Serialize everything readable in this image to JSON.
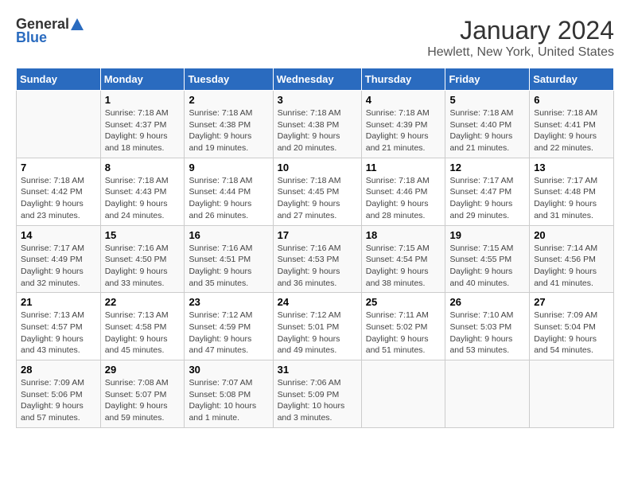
{
  "logo": {
    "general": "General",
    "blue": "Blue"
  },
  "title": "January 2024",
  "subtitle": "Hewlett, New York, United States",
  "headers": [
    "Sunday",
    "Monday",
    "Tuesday",
    "Wednesday",
    "Thursday",
    "Friday",
    "Saturday"
  ],
  "weeks": [
    [
      {
        "day": "",
        "info": ""
      },
      {
        "day": "1",
        "info": "Sunrise: 7:18 AM\nSunset: 4:37 PM\nDaylight: 9 hours\nand 18 minutes."
      },
      {
        "day": "2",
        "info": "Sunrise: 7:18 AM\nSunset: 4:38 PM\nDaylight: 9 hours\nand 19 minutes."
      },
      {
        "day": "3",
        "info": "Sunrise: 7:18 AM\nSunset: 4:38 PM\nDaylight: 9 hours\nand 20 minutes."
      },
      {
        "day": "4",
        "info": "Sunrise: 7:18 AM\nSunset: 4:39 PM\nDaylight: 9 hours\nand 21 minutes."
      },
      {
        "day": "5",
        "info": "Sunrise: 7:18 AM\nSunset: 4:40 PM\nDaylight: 9 hours\nand 21 minutes."
      },
      {
        "day": "6",
        "info": "Sunrise: 7:18 AM\nSunset: 4:41 PM\nDaylight: 9 hours\nand 22 minutes."
      }
    ],
    [
      {
        "day": "7",
        "info": "Sunrise: 7:18 AM\nSunset: 4:42 PM\nDaylight: 9 hours\nand 23 minutes."
      },
      {
        "day": "8",
        "info": "Sunrise: 7:18 AM\nSunset: 4:43 PM\nDaylight: 9 hours\nand 24 minutes."
      },
      {
        "day": "9",
        "info": "Sunrise: 7:18 AM\nSunset: 4:44 PM\nDaylight: 9 hours\nand 26 minutes."
      },
      {
        "day": "10",
        "info": "Sunrise: 7:18 AM\nSunset: 4:45 PM\nDaylight: 9 hours\nand 27 minutes."
      },
      {
        "day": "11",
        "info": "Sunrise: 7:18 AM\nSunset: 4:46 PM\nDaylight: 9 hours\nand 28 minutes."
      },
      {
        "day": "12",
        "info": "Sunrise: 7:17 AM\nSunset: 4:47 PM\nDaylight: 9 hours\nand 29 minutes."
      },
      {
        "day": "13",
        "info": "Sunrise: 7:17 AM\nSunset: 4:48 PM\nDaylight: 9 hours\nand 31 minutes."
      }
    ],
    [
      {
        "day": "14",
        "info": "Sunrise: 7:17 AM\nSunset: 4:49 PM\nDaylight: 9 hours\nand 32 minutes."
      },
      {
        "day": "15",
        "info": "Sunrise: 7:16 AM\nSunset: 4:50 PM\nDaylight: 9 hours\nand 33 minutes."
      },
      {
        "day": "16",
        "info": "Sunrise: 7:16 AM\nSunset: 4:51 PM\nDaylight: 9 hours\nand 35 minutes."
      },
      {
        "day": "17",
        "info": "Sunrise: 7:16 AM\nSunset: 4:53 PM\nDaylight: 9 hours\nand 36 minutes."
      },
      {
        "day": "18",
        "info": "Sunrise: 7:15 AM\nSunset: 4:54 PM\nDaylight: 9 hours\nand 38 minutes."
      },
      {
        "day": "19",
        "info": "Sunrise: 7:15 AM\nSunset: 4:55 PM\nDaylight: 9 hours\nand 40 minutes."
      },
      {
        "day": "20",
        "info": "Sunrise: 7:14 AM\nSunset: 4:56 PM\nDaylight: 9 hours\nand 41 minutes."
      }
    ],
    [
      {
        "day": "21",
        "info": "Sunrise: 7:13 AM\nSunset: 4:57 PM\nDaylight: 9 hours\nand 43 minutes."
      },
      {
        "day": "22",
        "info": "Sunrise: 7:13 AM\nSunset: 4:58 PM\nDaylight: 9 hours\nand 45 minutes."
      },
      {
        "day": "23",
        "info": "Sunrise: 7:12 AM\nSunset: 4:59 PM\nDaylight: 9 hours\nand 47 minutes."
      },
      {
        "day": "24",
        "info": "Sunrise: 7:12 AM\nSunset: 5:01 PM\nDaylight: 9 hours\nand 49 minutes."
      },
      {
        "day": "25",
        "info": "Sunrise: 7:11 AM\nSunset: 5:02 PM\nDaylight: 9 hours\nand 51 minutes."
      },
      {
        "day": "26",
        "info": "Sunrise: 7:10 AM\nSunset: 5:03 PM\nDaylight: 9 hours\nand 53 minutes."
      },
      {
        "day": "27",
        "info": "Sunrise: 7:09 AM\nSunset: 5:04 PM\nDaylight: 9 hours\nand 54 minutes."
      }
    ],
    [
      {
        "day": "28",
        "info": "Sunrise: 7:09 AM\nSunset: 5:06 PM\nDaylight: 9 hours\nand 57 minutes."
      },
      {
        "day": "29",
        "info": "Sunrise: 7:08 AM\nSunset: 5:07 PM\nDaylight: 9 hours\nand 59 minutes."
      },
      {
        "day": "30",
        "info": "Sunrise: 7:07 AM\nSunset: 5:08 PM\nDaylight: 10 hours\nand 1 minute."
      },
      {
        "day": "31",
        "info": "Sunrise: 7:06 AM\nSunset: 5:09 PM\nDaylight: 10 hours\nand 3 minutes."
      },
      {
        "day": "",
        "info": ""
      },
      {
        "day": "",
        "info": ""
      },
      {
        "day": "",
        "info": ""
      }
    ]
  ]
}
